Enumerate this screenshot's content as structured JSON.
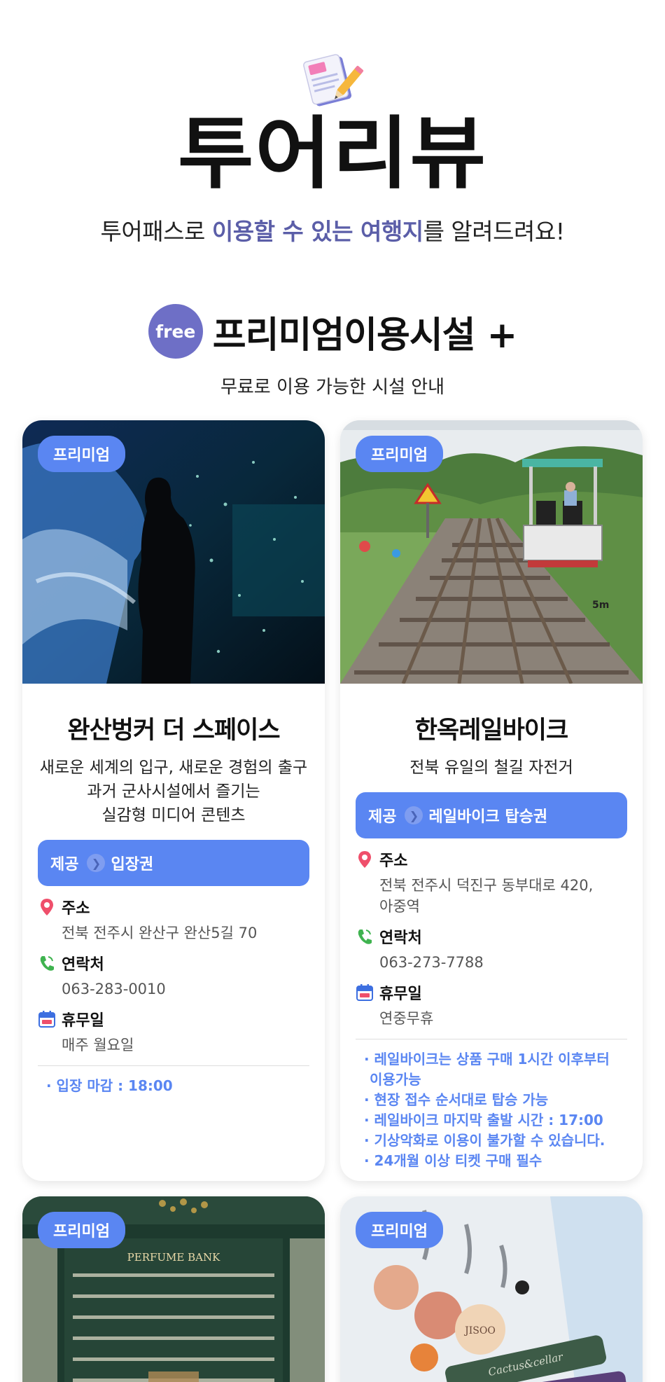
{
  "header": {
    "title": "투어리뷰",
    "subtitle_pre": "투어패스로 ",
    "subtitle_hl1": "이용할 수 있는 여행지",
    "subtitle_post": "를 알려드려요!"
  },
  "section": {
    "badge": "free",
    "title": "프리미엄이용시설 +",
    "subtitle": "무료로 이용 가능한 시설 안내"
  },
  "labels": {
    "premium": "프리미엄",
    "provide": "제공",
    "address": "주소",
    "contact": "연락처",
    "holiday": "휴무일"
  },
  "cards": [
    {
      "title": "완산벙커 더 스페이스",
      "desc": [
        "새로운 세계의 입구, 새로운 경험의 출구",
        "과거 군사시설에서 즐기는",
        "실감형 미디어 콘텐츠"
      ],
      "provide": "입장권",
      "address": "전북 전주시 완산구 완산5길 70",
      "contact": "063-283-0010",
      "holiday": "매주 월요일",
      "notes": [
        "· 입장 마감 : 18:00"
      ]
    },
    {
      "title": "한옥레일바이크",
      "desc": [
        "전북 유일의 철길 자전거"
      ],
      "provide": "레일바이크 탑승권",
      "address_lines": [
        "전북 전주시 덕진구 동부대로 420,",
        "아중역"
      ],
      "contact": "063-273-7788",
      "holiday": "연중무휴",
      "notes": [
        "· 레일바이크는 상품 구매 1시간 이후부터",
        "이용가능",
        "· 현장 접수 순서대로 탑승 가능",
        "· 레일바이크 마지막 출발 시간 : 17:00",
        "· 기상악화로 이용이 불가할 수 있습니다.",
        "· 24개월 이상 티켓 구매 필수"
      ]
    }
  ],
  "image_texts": {
    "perfume": "PERFUME BANK",
    "rail_sign": "5m",
    "keychain_a": "JISOO",
    "keychain_b": "Cactus&cellar"
  },
  "colors": {
    "accent_blue": "#5a86f2",
    "free_purple": "#6e6fc6",
    "highlight_text": "#5b5ea8"
  }
}
